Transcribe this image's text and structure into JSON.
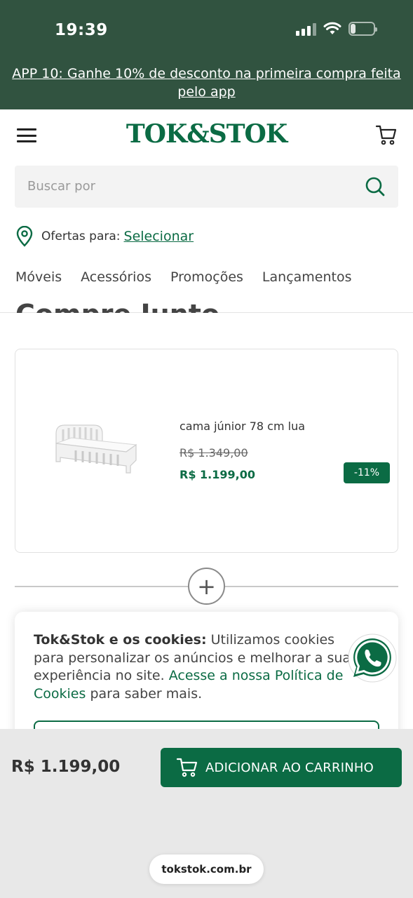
{
  "colors": {
    "brand_green": "#0b6b44",
    "status_bg": "#315340",
    "bottom_bg": "#e8e8e8"
  },
  "status_bar": {
    "time": "19:39",
    "battery": "21",
    "icons": [
      "signal-icon",
      "wifi-icon",
      "battery-icon"
    ]
  },
  "promo_banner": {
    "text": "APP 10: Ganhe 10% de desconto na primeira compra feita pelo app"
  },
  "header": {
    "logo": "TOK&STOK",
    "icons": [
      "menu-icon",
      "cart-icon"
    ],
    "search": {
      "placeholder": "Buscar por",
      "icon": "search-icon"
    },
    "offers": {
      "label": "Ofertas para:",
      "link": "Selecionar",
      "icon": "location-pin-icon"
    },
    "nav": [
      "Móveis",
      "Acessórios",
      "Promoções",
      "Lançamentos"
    ]
  },
  "section": {
    "title": "Compre Junto"
  },
  "product": {
    "name": "cama júnior 78 cm lua",
    "old_price": "R$ 1.349,00",
    "price": "R$ 1.199,00",
    "discount": "-11%",
    "image": "white-junior-bed"
  },
  "combine": {
    "symbol": "+"
  },
  "cookies": {
    "title": "Tok&Stok e os cookies:",
    "text": "Utilizamos cookies para personalizar os anúncios e melhorar a sua experiência no site.",
    "link": "Acesse a nossa Política de Cookies",
    "suffix": "para saber mais."
  },
  "bottom": {
    "price": "R$ 1.199,00",
    "add_to_cart": "ADICIONAR AO CARRINHO",
    "url": "tokstok.com.br"
  }
}
